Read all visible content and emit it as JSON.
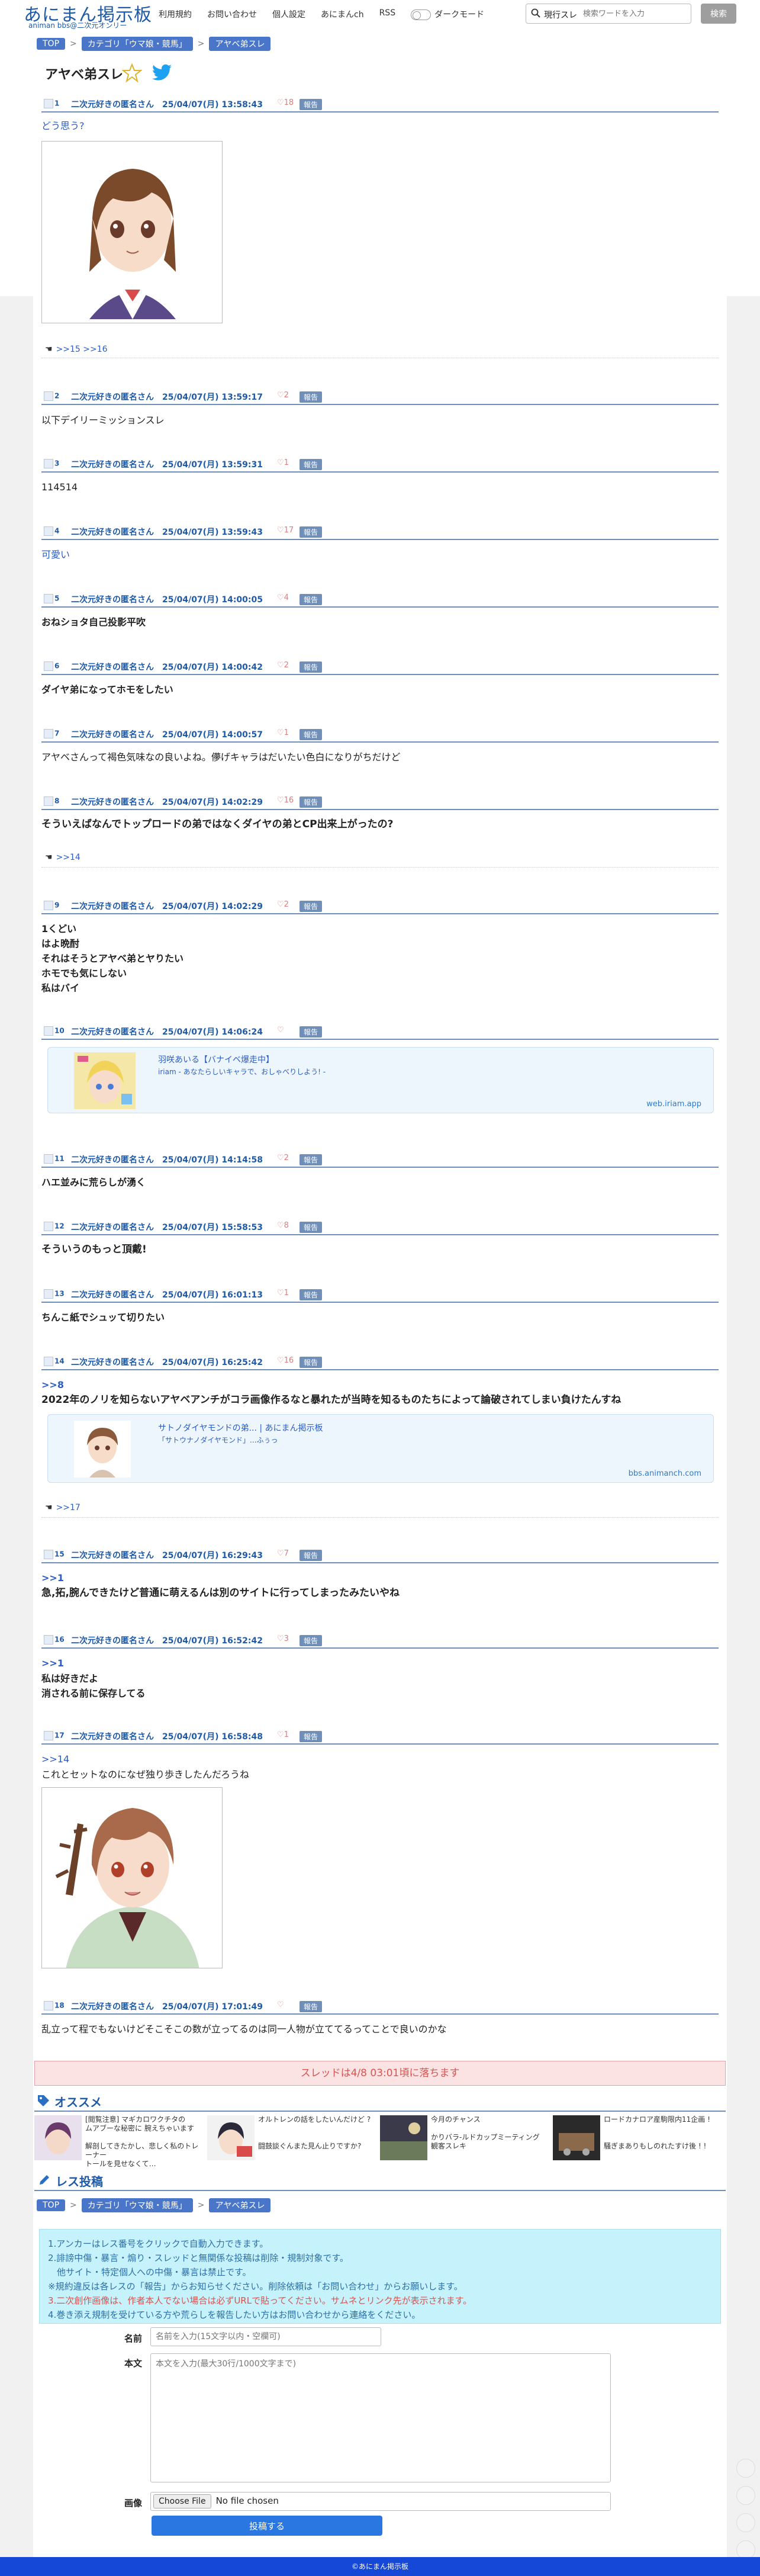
{
  "header": {
    "logo": "あにまん掲示板",
    "logo_sub": "animan bbs@二次元オンリー",
    "nav": [
      "利用規約",
      "お問い合わせ",
      "個人設定",
      "あにまんch",
      "RSS"
    ],
    "dark_mode_label": "ダークモード",
    "search_scope": "現行スレ",
    "search_placeholder": "検索ワードを入力",
    "search_button": "検索"
  },
  "breadcrumbs": [
    "TOP",
    "カテゴリ「ウマ娘・競馬」",
    "アヤベ弟スレ"
  ],
  "thread": {
    "title": "アヤベ弟スレ"
  },
  "posts": [
    {
      "num": "1",
      "author": "二次元好きの匿名さん",
      "date": "25/04/07(月) 13:58:43",
      "likes": "18",
      "report": "報告",
      "body": [
        "どう思う?"
      ],
      "replies": ">>15 >>16"
    },
    {
      "num": "2",
      "author": "二次元好きの匿名さん",
      "date": "25/04/07(月) 13:59:17",
      "likes": "2",
      "report": "報告",
      "body": [
        "以下デイリーミッションスレ"
      ]
    },
    {
      "num": "3",
      "author": "二次元好きの匿名さん",
      "date": "25/04/07(月) 13:59:31",
      "likes": "1",
      "report": "報告",
      "body": [
        "114514"
      ]
    },
    {
      "num": "4",
      "author": "二次元好きの匿名さん",
      "date": "25/04/07(月) 13:59:43",
      "likes": "17",
      "report": "報告",
      "body": [
        "可愛い"
      ]
    },
    {
      "num": "5",
      "author": "二次元好きの匿名さん",
      "date": "25/04/07(月) 14:00:05",
      "likes": "4",
      "report": "報告",
      "body": [
        "おねショタ自己投影平吹"
      ]
    },
    {
      "num": "6",
      "author": "二次元好きの匿名さん",
      "date": "25/04/07(月) 14:00:42",
      "likes": "2",
      "report": "報告",
      "body": [
        "ダイヤ弟になってホモをしたい"
      ]
    },
    {
      "num": "7",
      "author": "二次元好きの匿名さん",
      "date": "25/04/07(月) 14:00:57",
      "likes": "1",
      "report": "報告",
      "body": [
        "アヤベさんって褐色気味なの良いよね。儚げキャラはだいたい色白になりがちだけど"
      ]
    },
    {
      "num": "8",
      "author": "二次元好きの匿名さん",
      "date": "25/04/07(月) 14:02:29",
      "likes": "16",
      "report": "報告",
      "body": [
        "そういえばなんでトップロードの弟ではなくダイヤの弟とCP出来上がったの?"
      ],
      "replies": ">>14"
    },
    {
      "num": "9",
      "author": "二次元好きの匿名さん",
      "date": "25/04/07(月) 14:02:29",
      "likes": "2",
      "report": "報告",
      "body": [
        "1くどい",
        "はよ晩酎",
        "それはそうとアヤベ弟とヤりたい",
        "ホモでも気にしない",
        "私はバイ"
      ]
    },
    {
      "num": "10",
      "author": "二次元好きの匿名さん",
      "date": "25/04/07(月) 14:06:24",
      "likes": "",
      "report": "報告",
      "card": {
        "title": "羽咲あいる【バナイベ爆走中】",
        "desc": "iriam - あなたらしいキャラで、おしゃべりしよう! -",
        "url": "web.iriam.app"
      }
    },
    {
      "num": "11",
      "author": "二次元好きの匿名さん",
      "date": "25/04/07(月) 14:14:58",
      "likes": "2",
      "report": "報告",
      "body": [
        "ハエ並みに荒らしが湧く"
      ]
    },
    {
      "num": "12",
      "author": "二次元好きの匿名さん",
      "date": "25/04/07(月) 15:58:53",
      "likes": "8",
      "report": "報告",
      "body": [
        "そういうのもっと頂戴!"
      ]
    },
    {
      "num": "13",
      "author": "二次元好きの匿名さん",
      "date": "25/04/07(月) 16:01:13",
      "likes": "1",
      "report": "報告",
      "body": [
        "ちんこ紙でシュッて切りたい"
      ]
    },
    {
      "num": "14",
      "author": "二次元好きの匿名さん",
      "date": "25/04/07(月) 16:25:42",
      "likes": "16",
      "report": "報告",
      "anchor": ">>8",
      "body": [
        "2022年のノリを知らないアヤベアンチがコラ画像作るなと暴れたが当時を知るものたちによって論破されてしまい負けたんすね"
      ],
      "card": {
        "title": "サトノダイヤモンドの弟... | あにまん掲示板",
        "desc": "「サトウナノダイヤモンド」...ふぅっ",
        "url": "bbs.animanch.com"
      },
      "replies": ">>17"
    },
    {
      "num": "15",
      "author": "二次元好きの匿名さん",
      "date": "25/04/07(月) 16:29:43",
      "likes": "7",
      "report": "報告",
      "anchor": ">>1",
      "body": [
        "急,拓,腕んできたけど普通に萌えるんは別のサイトに行ってしまったみたいやね"
      ]
    },
    {
      "num": "16",
      "author": "二次元好きの匿名さん",
      "date": "25/04/07(月) 16:52:42",
      "likes": "3",
      "report": "報告",
      "anchor": ">>1",
      "body": [
        "私は好きだよ",
        "消される前に保存してる"
      ]
    },
    {
      "num": "17",
      "author": "二次元好きの匿名さん",
      "date": "25/04/07(月) 16:58:48",
      "likes": "1",
      "report": "報告",
      "anchor": ">>14",
      "body": [
        "これとセットなのになぜ独り歩きしたんだろうね"
      ]
    },
    {
      "num": "18",
      "author": "二次元好きの匿名さん",
      "date": "25/04/07(月) 17:01:49",
      "likes": "",
      "report": "報告",
      "body": [
        "乱立って程でもないけどそこそこの数が立ってるのは同一人物が立ててるってことで良いのかな"
      ]
    }
  ],
  "notice": "スレッドは4/8 03:01頃に落ちます",
  "recommend": {
    "title": "オススメ",
    "items": [
      {
        "text": "[閲覧注意] マギカロワクチタの\nムアブーな秘密に 腕えちゃいます\n\n解剖してきたかし、悲しく私のトレーナー\nトールを見せなくて…"
      },
      {
        "text": "オルトレンの話をしたいんだけど ?\n\n\n闘鼓談ぐんまた見ん止りですか?"
      },
      {
        "text": "今月のチャンス\n\nかりバラ-ルドカップミーティング\n観客スレキ"
      },
      {
        "text": "ロードカナロア産駒限内11企画 !\n\n\n騒ぎまありもしのれたすけ後 ! !"
      }
    ]
  },
  "reply_form": {
    "title": "レス投稿",
    "rules": [
      {
        "text": "1.アンカーはレス番号をクリックで自動入力できます。",
        "red": false
      },
      {
        "text": "2.誹謗中傷・暴言・煽り・スレッドと無関係な投稿は削除・規制対象です。",
        "red": false
      },
      {
        "text": "　他サイト・特定個人への中傷・暴言は禁止です。",
        "red": false
      },
      {
        "text": "※規約違反は各レスの「報告」からお知らせください。削除依頼は「お問い合わせ」からお願いします。",
        "red": false
      },
      {
        "text": "3.二次創作画像は、作者本人でない場合は必ずURLで貼ってください。サムネとリンク先が表示されます。",
        "red": true
      },
      {
        "text": "4.巻き添え規制を受けている方や荒らしを報告したい方はお問い合わせから連絡をください。",
        "red": false
      }
    ],
    "name_label": "名前",
    "name_placeholder": "名前を入力(15文字以内・空欄可)",
    "body_label": "本文",
    "body_placeholder": "本文を入力(最大30行/1000文字まで)",
    "image_label": "画像",
    "file_button": "Choose File",
    "file_status": "No file chosen",
    "submit": "投稿する"
  },
  "footer": "©あにまん掲示板",
  "colors": {
    "accent": "#1e5aa8",
    "report": "#6f8fb8",
    "footer": "#1548d6",
    "notice": "#fbe3e4",
    "rules_bg": "#c6f2fb"
  }
}
